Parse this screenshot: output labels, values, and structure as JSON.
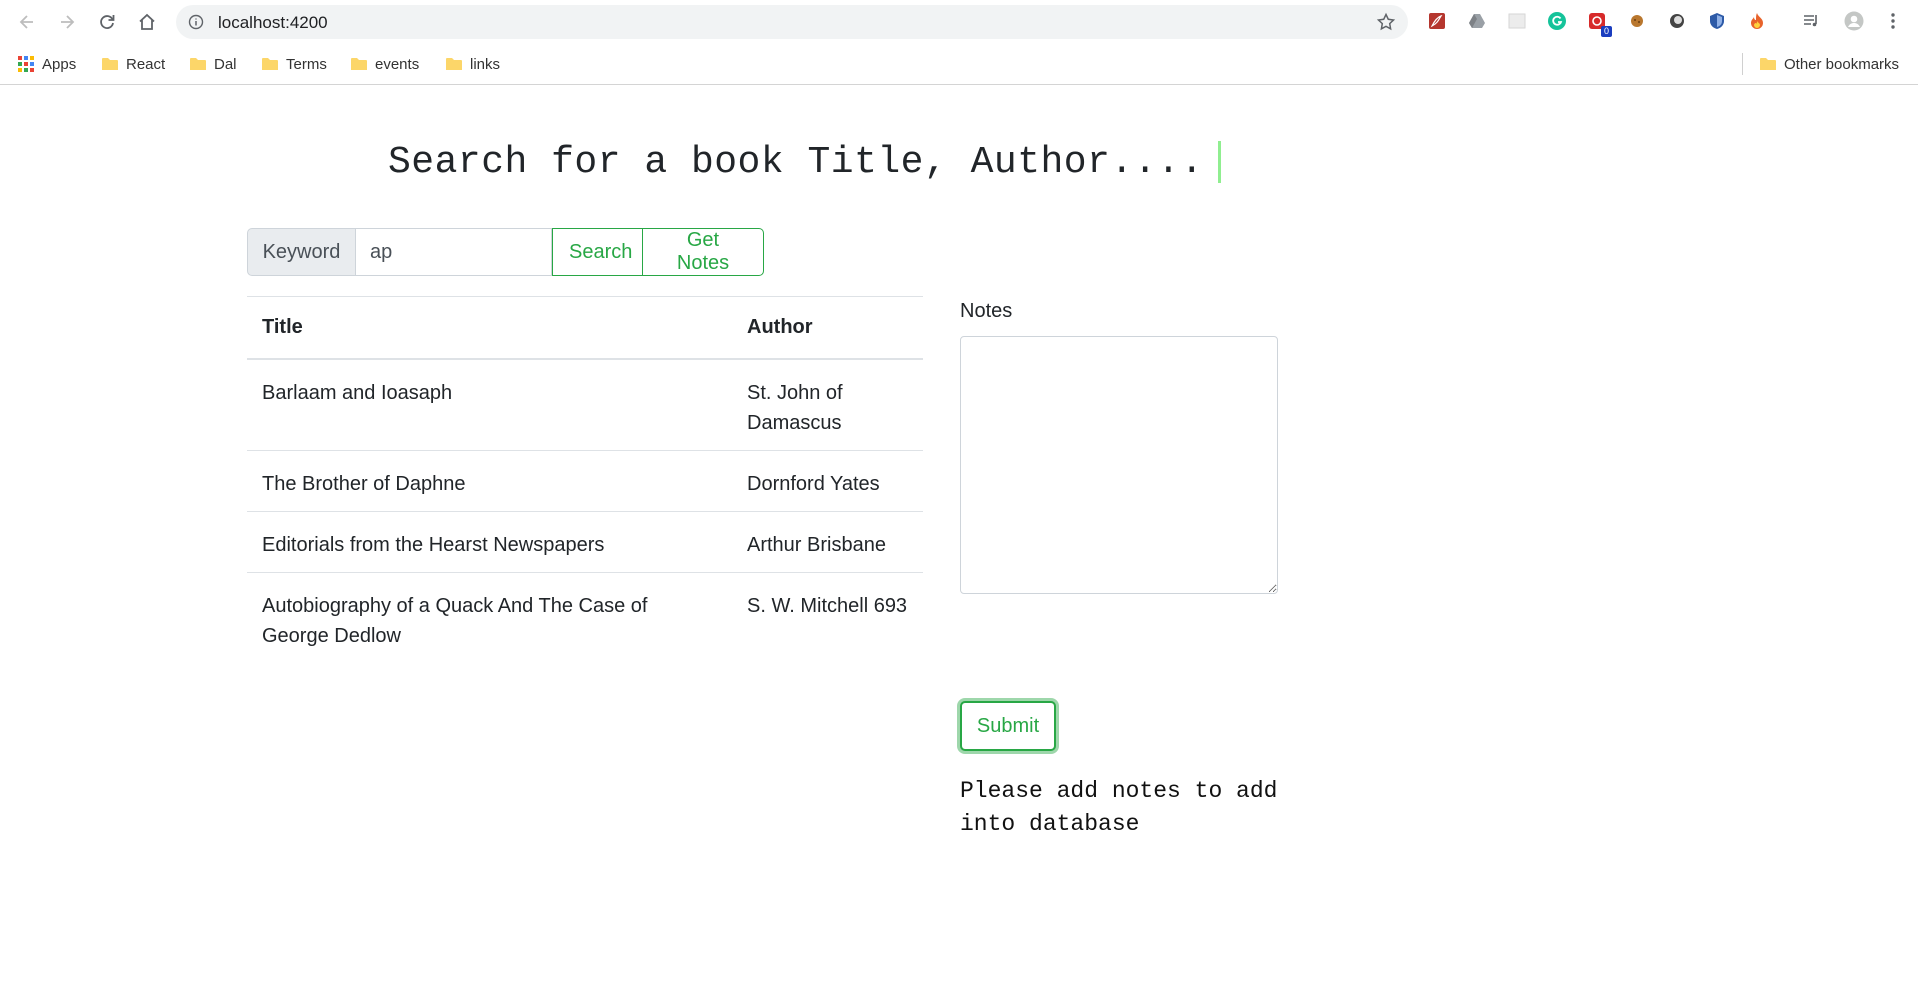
{
  "browser": {
    "url": "localhost:4200",
    "bookmarks": [
      {
        "label": "Apps",
        "icon": "apps-grid-icon"
      },
      {
        "label": "React",
        "icon": "folder-icon"
      },
      {
        "label": "Dal",
        "icon": "folder-icon"
      },
      {
        "label": "Terms",
        "icon": "folder-icon"
      },
      {
        "label": "events",
        "icon": "folder-icon"
      },
      {
        "label": "links",
        "icon": "folder-icon"
      }
    ],
    "other_bookmarks": "Other bookmarks",
    "extension_badge": "0"
  },
  "page": {
    "heading": "Search for a book Title, Author....",
    "search": {
      "addon_label": "Keyword",
      "value": "ap",
      "search_button": "Search",
      "notes_button": "Get Notes"
    },
    "table": {
      "headers": [
        "Title",
        "Author"
      ],
      "rows": [
        [
          "Barlaam and Ioasaph",
          "St. John of Damascus"
        ],
        [
          "The Brother of Daphne",
          "Dornford Yates"
        ],
        [
          "Editorials from the Hearst Newspapers",
          "Arthur Brisbane"
        ],
        [
          "Autobiography of a Quack And The Case of George Dedlow",
          "S. W. Mitchell 693"
        ]
      ]
    },
    "notes": {
      "label": "Notes",
      "value": "",
      "submit_button": "Submit",
      "message": "Please add notes to add into database"
    }
  },
  "colors": {
    "accent_green": "#28a745",
    "caret": "#90ee90",
    "addon_bg": "#e9ecef"
  }
}
